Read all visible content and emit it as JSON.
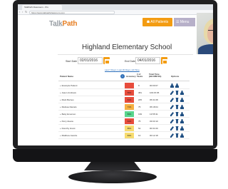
{
  "browser": {
    "tab_title": "TalkPath Classroom - Pro",
    "url": "https://www.talkpathclassroom.com"
  },
  "app": {
    "logo_main_1": "Talk",
    "logo_main_2": "Path",
    "logo_sub": "Classroom",
    "all_patients_label": "All Patients",
    "menu_label": "Menu"
  },
  "school": {
    "title": "Highland Elementary School",
    "start_label": "Start Date",
    "start_value": "02/01/2016",
    "end_label": "End Date",
    "end_value": "04/01/2016",
    "quick_links": "Last 7 Days | Last 30 Days | All Time"
  },
  "table": {
    "headers": {
      "name": "Patient Name",
      "accuracy": "Accuracy",
      "tasks": "# of Tasks",
      "time": "Total Time (HH:MM:SS)",
      "options": "Options"
    },
    "rows": [
      {
        "name": "+ Example Patient",
        "accuracy": "",
        "tasks": "9",
        "time": "00:00:07"
      },
      {
        "name": "+ Jason Andrews",
        "accuracy": "59%",
        "tasks": "381",
        "time": "109:15:05"
      },
      {
        "name": "+ Mark Barnes",
        "accuracy": "61%",
        "tasks": "205",
        "time": "05:31:08"
      },
      {
        "name": "+ Melissa Daniels",
        "accuracy": "71%",
        "tasks": "75",
        "time": "05:18:04"
      },
      {
        "name": "+ Betty Emerson",
        "accuracy": "83%",
        "tasks": "199",
        "time": "13:55:31"
      },
      {
        "name": "+ Perry Evans",
        "accuracy": "61%",
        "tasks": "75",
        "time": "03:03:10"
      },
      {
        "name": "+ Dorothy Grant",
        "accuracy": "85%",
        "tasks": "52",
        "time": "00:31:00"
      },
      {
        "name": "+ Matthew Jacobs",
        "accuracy": "84%",
        "tasks": "10",
        "time": "00:12:18"
      }
    ]
  },
  "colors": {
    "accent_orange": "#f39c12",
    "menu_purple": "#b7b0c9",
    "acc_red": "#e74c3c",
    "acc_orange": "#f5b041",
    "acc_yellow": "#f7dc6f",
    "acc_green": "#58d68d",
    "icon_blue": "#1f4f82"
  }
}
